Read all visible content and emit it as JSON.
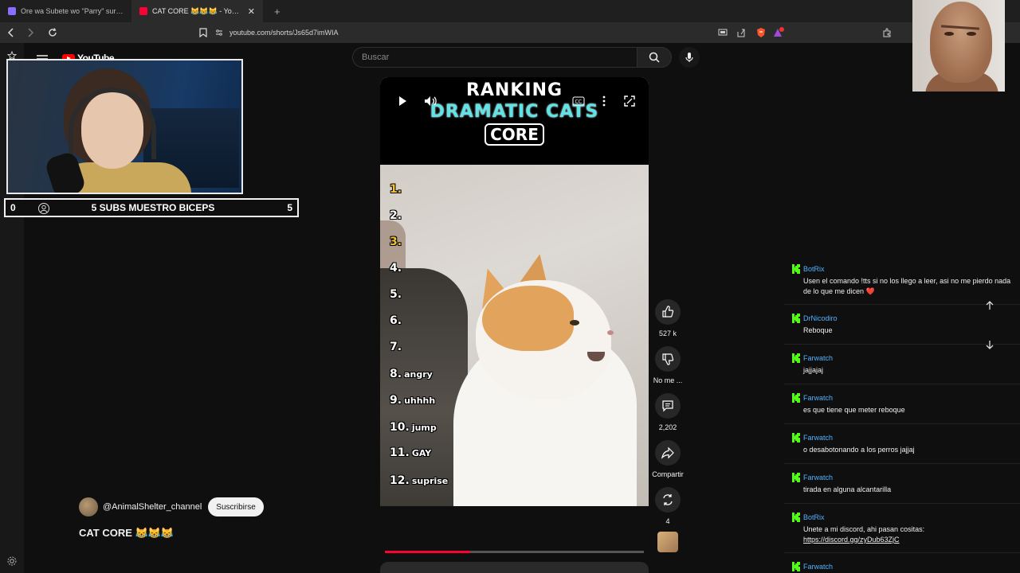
{
  "browser": {
    "tabs": [
      {
        "title": "Ore wa Subete wo \"Parry\" suru: Gyak",
        "active": false,
        "favicon_color": "#8a6cff"
      },
      {
        "title": "CAT CORE 😹😹😹 - YouTube",
        "active": true,
        "favicon_color": "#ff0033"
      }
    ],
    "new_tab": "+",
    "url": "youtube.com/shorts/Js65d7imWIA"
  },
  "youtube": {
    "logo_text": "YouTube",
    "search_placeholder": "Buscar",
    "short": {
      "title_line1": "RANKING",
      "title_line2": "DRAMATIC CATS",
      "title_line3": "CORE",
      "ranks": [
        {
          "num": "1.",
          "label": "",
          "color": "#f2c230"
        },
        {
          "num": "2.",
          "label": "",
          "color": "#ffffff"
        },
        {
          "num": "3.",
          "label": "",
          "color": "#f2c230"
        },
        {
          "num": "4.",
          "label": "",
          "color": "#ffffff"
        },
        {
          "num": "5.",
          "label": "",
          "color": "#ffffff"
        },
        {
          "num": "6.",
          "label": "",
          "color": "#ffffff"
        },
        {
          "num": "7.",
          "label": "",
          "color": "#ffffff"
        },
        {
          "num": "8.",
          "label": "angry",
          "color": "#ffffff"
        },
        {
          "num": "9.",
          "label": "uhhhh",
          "color": "#ffffff"
        },
        {
          "num": "10.",
          "label": "jump",
          "color": "#ffffff"
        },
        {
          "num": "11.",
          "label": "GAY",
          "color": "#ffffff"
        },
        {
          "num": "12.",
          "label": "suprise",
          "color": "#ffffff"
        }
      ],
      "progress": 0.33
    },
    "actions": {
      "like_count": "527 k",
      "dislike_label": "No me ...",
      "comments_count": "2,202",
      "share_label": "Compartir",
      "remix_count": "4"
    },
    "channel": {
      "name": "@AnimalShelter_channel",
      "subscribe_label": "Suscribirse"
    },
    "video_title": "CAT CORE 😹😹😹"
  },
  "overlay": {
    "goal": {
      "min": "0",
      "label": "5 SUBS MUESTRO BICEPS",
      "max": "5"
    }
  },
  "chat": {
    "messages": [
      {
        "user": "BotRix",
        "text": "Usen el comando !tts si no los llego a leer, asi no me pierdo nada de lo que me dicen ❤️"
      },
      {
        "user": "DrNicodiro",
        "text": "Reboque"
      },
      {
        "user": "Farwatch",
        "text": "jajjajaj"
      },
      {
        "user": "Farwatch",
        "text": "es que tiene que meter reboque"
      },
      {
        "user": "Farwatch",
        "text": "o desabotonando a los perros jajjaj"
      },
      {
        "user": "Farwatch",
        "text": "tirada en alguna alcantarilla"
      },
      {
        "user": "BotRix",
        "text": "Unete a mi discord, ahi pasan cositas:",
        "link": "https://discord.gg/zyDub63ZjC"
      },
      {
        "user": "Farwatch",
        "text": ""
      }
    ]
  }
}
